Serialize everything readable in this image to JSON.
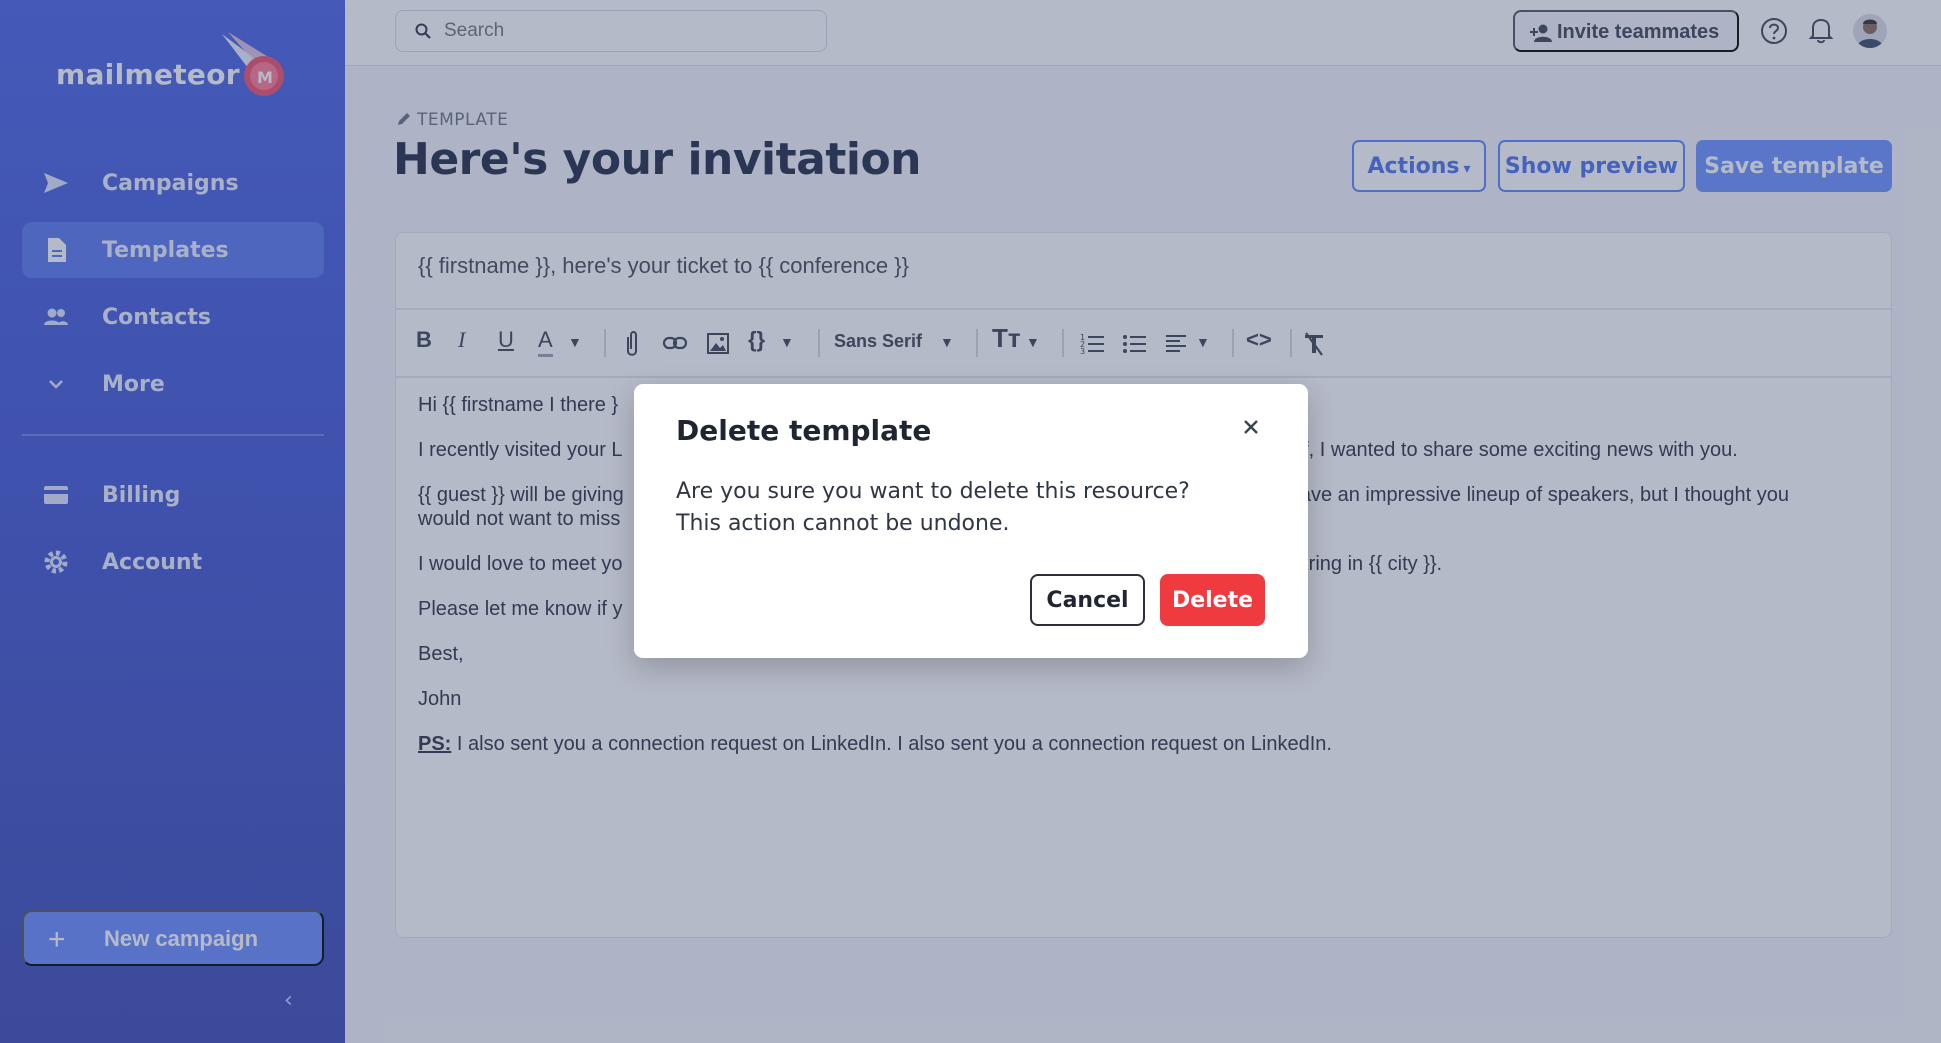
{
  "brand": {
    "name": "mailmeteor",
    "accent": "#4a63e6",
    "logo_icon": "meteor-icon"
  },
  "sidebar": {
    "items": [
      {
        "label": "Campaigns",
        "icon": "send-icon"
      },
      {
        "label": "Templates",
        "icon": "document-icon",
        "active": true
      },
      {
        "label": "Contacts",
        "icon": "people-icon"
      },
      {
        "label": "More",
        "icon": "chevron-down-icon"
      },
      {
        "label": "Billing",
        "icon": "credit-card-icon"
      },
      {
        "label": "Account",
        "icon": "gear-icon"
      }
    ],
    "new_campaign_label": "New campaign",
    "collapse_label": "‹"
  },
  "topbar": {
    "search_placeholder": "Search",
    "invite_label": "Invite teammates"
  },
  "page": {
    "eyebrow": "TEMPLATE",
    "title": "Here's your invitation",
    "actions_label": "Actions",
    "preview_label": "Show preview",
    "save_label": "Save template"
  },
  "editor": {
    "subject": "{{ firstname }}, here's your ticket to {{ conference }}",
    "toolbar": {
      "font_family": "Sans Serif"
    },
    "body": {
      "p1": "Hi {{ firstname I there }",
      "p2a": "I recently visited your L",
      "p2b": "elf, I wanted to share some exciting news with you.",
      "p3a": "{{ guest }} will be giving",
      "p3b": "have an impressive lineup of speakers, but I thought you",
      "p3c": "would not want to miss",
      "p4a": "I would love to meet yo",
      "p4b": "spring in {{ city }}.",
      "p5": "Please let me know if y",
      "p6": "Best,",
      "p7": "John",
      "ps_label": "PS:",
      "ps_text": " I also sent you a connection request on LinkedIn. I also sent you a connection request on LinkedIn."
    }
  },
  "modal": {
    "title": "Delete template",
    "message": "Are you sure you want to delete this resource? This action cannot be undone.",
    "cancel_label": "Cancel",
    "delete_label": "Delete",
    "danger_color": "#ef3b40"
  }
}
